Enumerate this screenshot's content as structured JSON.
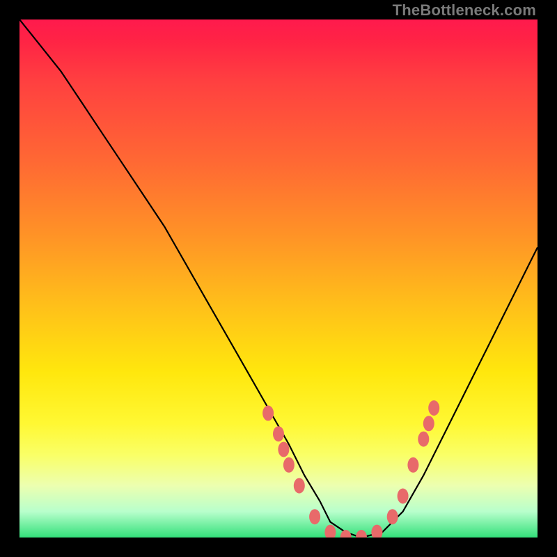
{
  "watermark": "TheBottleneck.com",
  "colors": {
    "frame": "#000000",
    "curve_stroke": "#000000",
    "marker_fill": "#e86a6a",
    "watermark_text": "#7a7a7a"
  },
  "chart_data": {
    "type": "line",
    "title": "",
    "xlabel": "",
    "ylabel": "",
    "xlim": [
      0,
      100
    ],
    "ylim": [
      0,
      100
    ],
    "grid": false,
    "series": [
      {
        "name": "bottleneck-curve",
        "x": [
          0,
          4,
          8,
          12,
          16,
          20,
          24,
          28,
          32,
          36,
          40,
          44,
          48,
          52,
          55,
          58,
          60,
          63,
          66,
          70,
          74,
          78,
          82,
          86,
          90,
          94,
          98,
          100
        ],
        "y": [
          100,
          95,
          90,
          84,
          78,
          72,
          66,
          60,
          53,
          46,
          39,
          32,
          25,
          18,
          12,
          7,
          3,
          1,
          0,
          1,
          5,
          12,
          20,
          28,
          36,
          44,
          52,
          56
        ]
      }
    ],
    "markers": [
      {
        "x": 48,
        "y": 24
      },
      {
        "x": 50,
        "y": 20
      },
      {
        "x": 51,
        "y": 17
      },
      {
        "x": 52,
        "y": 14
      },
      {
        "x": 54,
        "y": 10
      },
      {
        "x": 57,
        "y": 4
      },
      {
        "x": 60,
        "y": 1
      },
      {
        "x": 63,
        "y": 0
      },
      {
        "x": 66,
        "y": 0
      },
      {
        "x": 69,
        "y": 1
      },
      {
        "x": 72,
        "y": 4
      },
      {
        "x": 74,
        "y": 8
      },
      {
        "x": 76,
        "y": 14
      },
      {
        "x": 78,
        "y": 19
      },
      {
        "x": 79,
        "y": 22
      },
      {
        "x": 80,
        "y": 25
      }
    ]
  }
}
